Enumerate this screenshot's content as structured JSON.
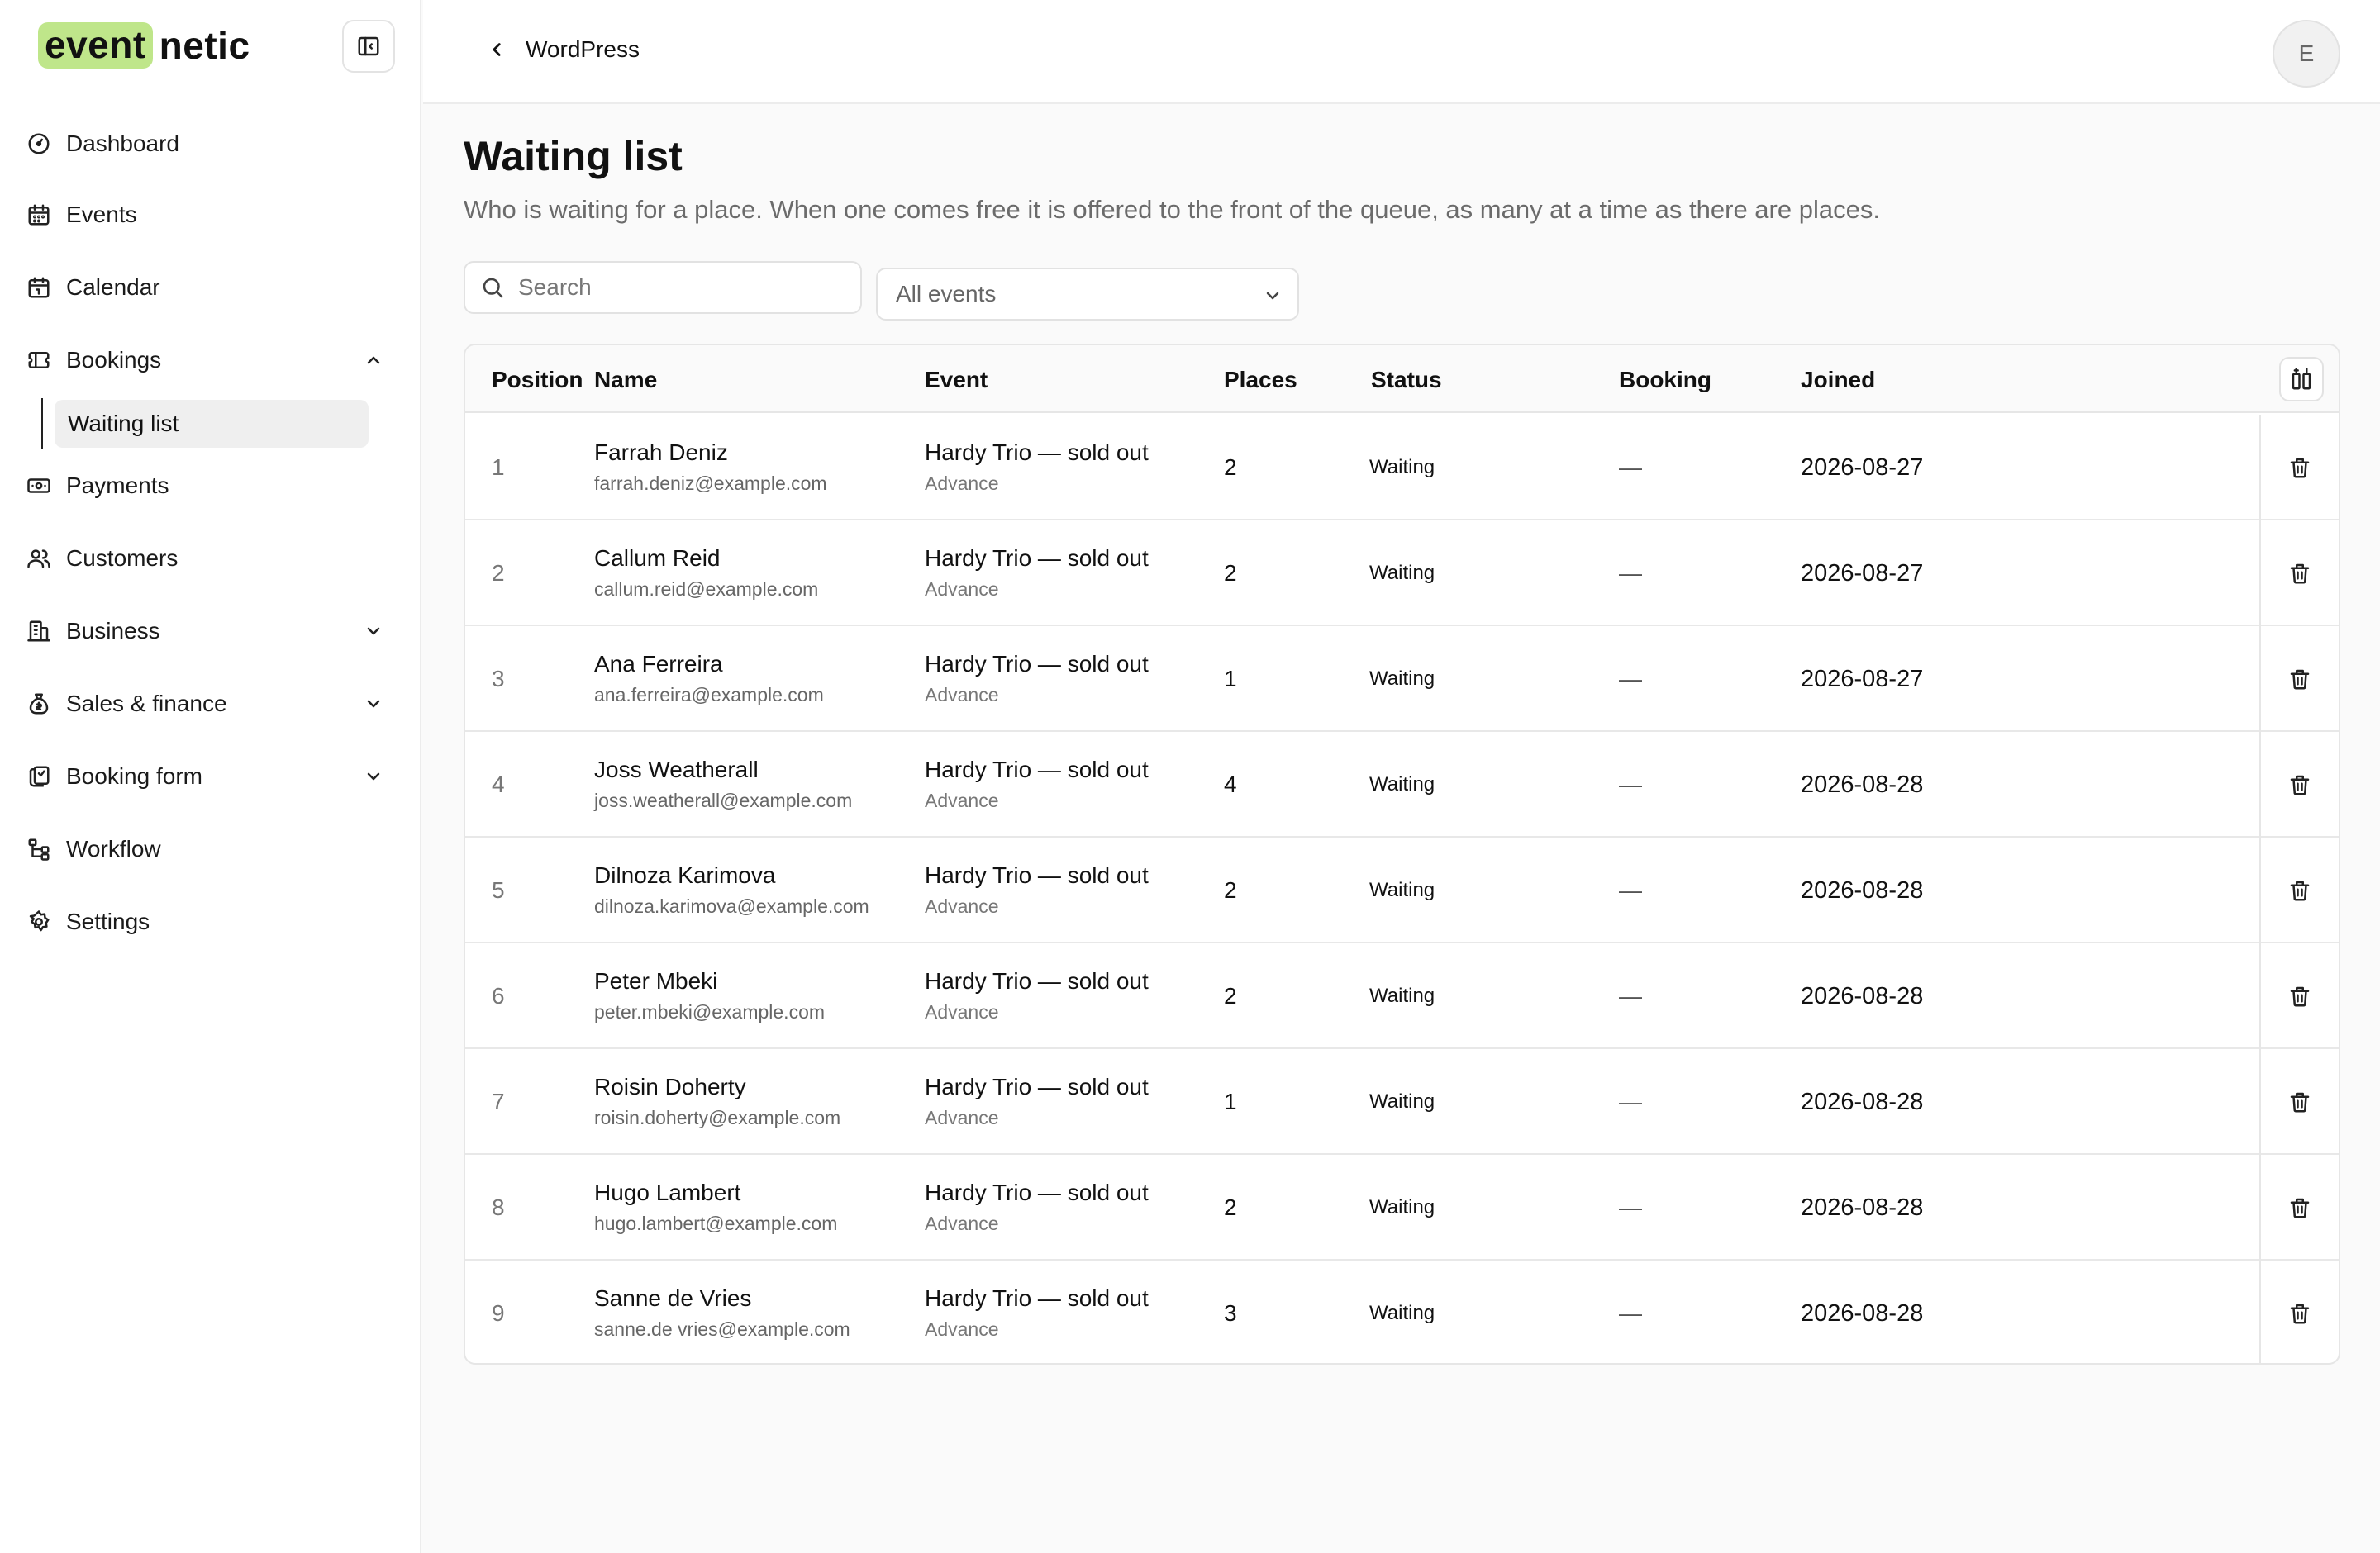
{
  "logo": {
    "highlight": "event",
    "rest": "netic"
  },
  "header": {
    "back_label": "WordPress",
    "avatar_initial": "E"
  },
  "sidebar": {
    "items": [
      {
        "label": "Dashboard"
      },
      {
        "label": "Events"
      },
      {
        "label": "Calendar"
      },
      {
        "label": "Bookings"
      },
      {
        "label": "Payments"
      },
      {
        "label": "Customers"
      },
      {
        "label": "Business"
      },
      {
        "label": "Sales & finance"
      },
      {
        "label": "Booking form"
      },
      {
        "label": "Workflow"
      },
      {
        "label": "Settings"
      }
    ],
    "sub_items": [
      {
        "label": "Waiting list"
      }
    ]
  },
  "main": {
    "title": "Waiting list",
    "description": "Who is waiting for a place. When one comes free it is offered to the front of the queue, as many at a time as there are places.",
    "search_placeholder": "Search",
    "filter_value": "All events"
  },
  "table": {
    "headers": [
      "Position",
      "Name",
      "Event",
      "Places",
      "Status",
      "Booking",
      "Joined"
    ],
    "rows": [
      {
        "position": "1",
        "name": "Farrah Deniz",
        "email": "farrah.deniz@example.com",
        "event": "Hardy Trio — sold out",
        "ticket": "Advance",
        "places": "2",
        "status": "Waiting",
        "booking": "—",
        "joined": "2026-08-27"
      },
      {
        "position": "2",
        "name": "Callum Reid",
        "email": "callum.reid@example.com",
        "event": "Hardy Trio — sold out",
        "ticket": "Advance",
        "places": "2",
        "status": "Waiting",
        "booking": "—",
        "joined": "2026-08-27"
      },
      {
        "position": "3",
        "name": "Ana Ferreira",
        "email": "ana.ferreira@example.com",
        "event": "Hardy Trio — sold out",
        "ticket": "Advance",
        "places": "1",
        "status": "Waiting",
        "booking": "—",
        "joined": "2026-08-27"
      },
      {
        "position": "4",
        "name": "Joss Weatherall",
        "email": "joss.weatherall@example.com",
        "event": "Hardy Trio — sold out",
        "ticket": "Advance",
        "places": "4",
        "status": "Waiting",
        "booking": "—",
        "joined": "2026-08-28"
      },
      {
        "position": "5",
        "name": "Dilnoza Karimova",
        "email": "dilnoza.karimova@example.com",
        "event": "Hardy Trio — sold out",
        "ticket": "Advance",
        "places": "2",
        "status": "Waiting",
        "booking": "—",
        "joined": "2026-08-28"
      },
      {
        "position": "6",
        "name": "Peter Mbeki",
        "email": "peter.mbeki@example.com",
        "event": "Hardy Trio — sold out",
        "ticket": "Advance",
        "places": "2",
        "status": "Waiting",
        "booking": "—",
        "joined": "2026-08-28"
      },
      {
        "position": "7",
        "name": "Roisin Doherty",
        "email": "roisin.doherty@example.com",
        "event": "Hardy Trio — sold out",
        "ticket": "Advance",
        "places": "1",
        "status": "Waiting",
        "booking": "—",
        "joined": "2026-08-28"
      },
      {
        "position": "8",
        "name": "Hugo Lambert",
        "email": "hugo.lambert@example.com",
        "event": "Hardy Trio — sold out",
        "ticket": "Advance",
        "places": "2",
        "status": "Waiting",
        "booking": "—",
        "joined": "2026-08-28"
      },
      {
        "position": "9",
        "name": "Sanne de Vries",
        "email": "sanne.de vries@example.com",
        "event": "Hardy Trio — sold out",
        "ticket": "Advance",
        "places": "3",
        "status": "Waiting",
        "booking": "—",
        "joined": "2026-08-28"
      }
    ]
  },
  "colors": {
    "accent": "#bfe68a",
    "border": "#e6e6e6",
    "muted": "#6b6b6b"
  }
}
